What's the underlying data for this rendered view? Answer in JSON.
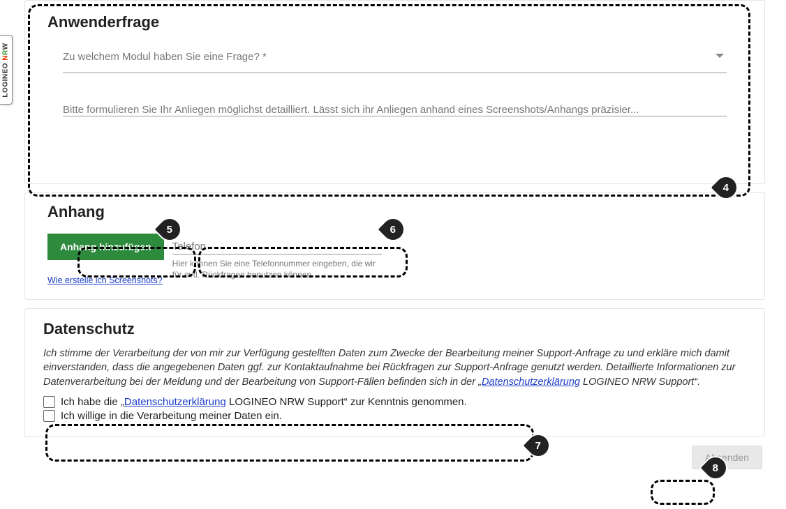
{
  "brand": {
    "part1": "LOGINEO",
    "part2": " N",
    "part3": "R",
    "part4": "W"
  },
  "anwenderfrage": {
    "title": "Anwenderfrage",
    "module_label": "Zu welchem Modul haben Sie eine Frage? *",
    "detail_placeholder": "Bitte formulieren Sie Ihr Anliegen möglichst detailliert. Lässt sich ihr Anliegen anhand eines Screenshots/Anhangs präzisier..."
  },
  "anhang": {
    "title": "Anhang",
    "add_button": "Anhang hinzufügen",
    "phone_placeholder": "Telefon",
    "phone_hint": "Hier können Sie eine Telefonnummer eingeben, die wir für evtl. Rückfragen benutzen können.",
    "screenshot_link": "Wie erstelle ich Screenshots?"
  },
  "datenschutz": {
    "title": "Datenschutz",
    "p_pre": "Ich stimme der Verarbeitung der von mir zur Verfügung gestellten Daten zum Zwecke der Bearbeitung meiner Support-Anfrage zu und erkläre mich damit einverstanden, dass die angegebenen Daten ggf. zur Kontaktaufnahme bei Rückfragen zur Support-Anfrage genutzt werden. Detaillierte Informationen zur Datenverarbeitung bei der Meldung und der Bearbeitung von Support-Fällen befinden sich in der „",
    "link1": "Datenschutzerklärung",
    "p_post": " LOGINEO NRW Support“.",
    "chk1_pre": "Ich habe die „",
    "chk1_link": "Datenschutzerklärung",
    "chk1_post": " LOGINEO NRW Support“ zur Kenntnis genommen.",
    "chk2": "Ich willige in die Verarbeitung meiner Daten ein."
  },
  "submit_label": "Absenden",
  "markers": {
    "m4": "4",
    "m5": "5",
    "m6": "6",
    "m7": "7",
    "m8": "8"
  }
}
